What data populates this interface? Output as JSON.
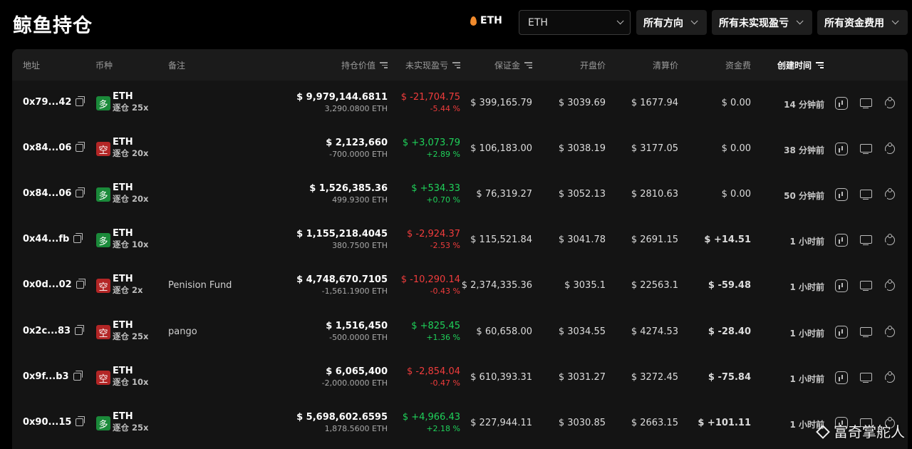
{
  "page_title": "鲸鱼持仓",
  "coin_label": "ETH",
  "coin_select_value": "ETH",
  "filters": [
    "所有方向",
    "所有未实现盈亏",
    "所有资金费用"
  ],
  "columns": {
    "address": "地址",
    "coin": "币种",
    "note": "备注",
    "value": "持仓价值",
    "pnl": "未实现盈亏",
    "margin": "保证金",
    "open": "开盘价",
    "liq": "清算价",
    "funding": "资金费",
    "created": "创建时间"
  },
  "rows": [
    {
      "address": "0x79...42",
      "side": "多",
      "coin": "ETH",
      "leverage": "逐仓 25x",
      "note": "",
      "value": "$ 9,979,144.6811",
      "size": "3,290.0800 ETH",
      "pnl": "$ -21,704.75",
      "pnl_pct": "-5.44 %",
      "margin": "$ 399,165.79",
      "open": "$ 3039.69",
      "liq": "$ 1677.94",
      "funding": "$ 0.00",
      "time": "14 分钟前"
    },
    {
      "address": "0x84...06",
      "side": "空",
      "coin": "ETH",
      "leverage": "逐仓 20x",
      "note": "",
      "value": "$ 2,123,660",
      "size": "-700.0000 ETH",
      "pnl": "$ +3,073.79",
      "pnl_pct": "+2.89 %",
      "margin": "$ 106,183.00",
      "open": "$ 3038.19",
      "liq": "$ 3177.05",
      "funding": "$ 0.00",
      "time": "38 分钟前"
    },
    {
      "address": "0x84...06",
      "side": "多",
      "coin": "ETH",
      "leverage": "逐仓 20x",
      "note": "",
      "value": "$ 1,526,385.36",
      "size": "499.9300 ETH",
      "pnl": "$ +534.33",
      "pnl_pct": "+0.70 %",
      "margin": "$ 76,319.27",
      "open": "$ 3052.13",
      "liq": "$ 2810.63",
      "funding": "$ 0.00",
      "time": "50 分钟前"
    },
    {
      "address": "0x44...fb",
      "side": "多",
      "coin": "ETH",
      "leverage": "逐仓 10x",
      "note": "",
      "value": "$ 1,155,218.4045",
      "size": "380.7500 ETH",
      "pnl": "$ -2,924.37",
      "pnl_pct": "-2.53 %",
      "margin": "$ 115,521.84",
      "open": "$ 3041.78",
      "liq": "$ 2691.15",
      "funding": "$ +14.51",
      "time": "1 小时前"
    },
    {
      "address": "0x0d...02",
      "side": "空",
      "coin": "ETH",
      "leverage": "逐仓 2x",
      "note": "Penision Fund",
      "value": "$ 4,748,670.7105",
      "size": "-1,561.1900 ETH",
      "pnl": "$ -10,290.14",
      "pnl_pct": "-0.43 %",
      "margin": "$ 2,374,335.36",
      "open": "$ 3035.1",
      "liq": "$ 22563.1",
      "funding": "$ -59.48",
      "time": "1 小时前"
    },
    {
      "address": "0x2c...83",
      "side": "空",
      "coin": "ETH",
      "leverage": "逐仓 25x",
      "note": "pango",
      "value": "$ 1,516,450",
      "size": "-500.0000 ETH",
      "pnl": "$ +825.45",
      "pnl_pct": "+1.36 %",
      "margin": "$ 60,658.00",
      "open": "$ 3034.55",
      "liq": "$ 4274.53",
      "funding": "$ -28.40",
      "time": "1 小时前"
    },
    {
      "address": "0x9f...b3",
      "side": "空",
      "coin": "ETH",
      "leverage": "逐仓 10x",
      "note": "",
      "value": "$ 6,065,400",
      "size": "-2,000.0000 ETH",
      "pnl": "$ -2,854.04",
      "pnl_pct": "-0.47 %",
      "margin": "$ 610,393.31",
      "open": "$ 3031.27",
      "liq": "$ 3272.45",
      "funding": "$ -75.84",
      "time": "1 小时前"
    },
    {
      "address": "0x90...15",
      "side": "多",
      "coin": "ETH",
      "leverage": "逐仓 25x",
      "note": "",
      "value": "$ 5,698,602.6595",
      "size": "1,878.5600 ETH",
      "pnl": "$ +4,966.43",
      "pnl_pct": "+2.18 %",
      "margin": "$ 227,944.11",
      "open": "$ 3030.85",
      "liq": "$ 2663.15",
      "funding": "$ +101.11",
      "time": "1 小时前"
    }
  ],
  "watermark": "富奇掌舵人",
  "colors": {
    "positive": "#1fd15a",
    "negative": "#f03c3c",
    "long_badge": "#1b8a3a",
    "short_badge": "#b32626"
  }
}
